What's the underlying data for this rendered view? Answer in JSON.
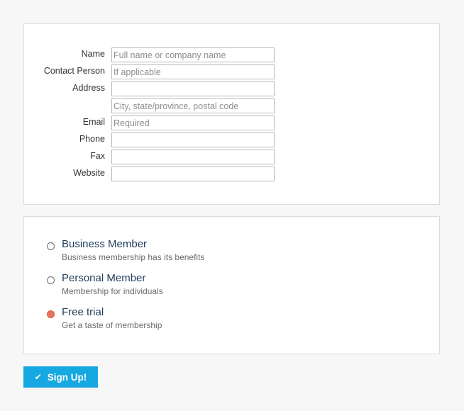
{
  "contact_form": {
    "fields": [
      {
        "label": "Name",
        "placeholder": "Full name or company name",
        "value": ""
      },
      {
        "label": "Contact Person",
        "placeholder": "If applicable",
        "value": ""
      },
      {
        "label": "Address",
        "placeholder": "",
        "value": ""
      },
      {
        "label": "",
        "placeholder": "City, state/province, postal code",
        "value": ""
      },
      {
        "label": "Email",
        "placeholder": "Required",
        "value": ""
      },
      {
        "label": "Phone",
        "placeholder": "",
        "value": ""
      },
      {
        "label": "Fax",
        "placeholder": "",
        "value": ""
      },
      {
        "label": "Website",
        "placeholder": "",
        "value": ""
      }
    ]
  },
  "membership": {
    "options": [
      {
        "title": "Business Member",
        "description": "Business membership has its benefits",
        "selected": false
      },
      {
        "title": "Personal Member",
        "description": "Membership for individuals",
        "selected": false
      },
      {
        "title": "Free trial",
        "description": "Get a taste of membership",
        "selected": true
      }
    ]
  },
  "actions": {
    "signup_label": "Sign Up!",
    "signup_icon": "checkmark-icon"
  },
  "colors": {
    "accent": "#16a8e0",
    "selected_radio": "#e8725c",
    "option_title": "#1e3c5a"
  }
}
